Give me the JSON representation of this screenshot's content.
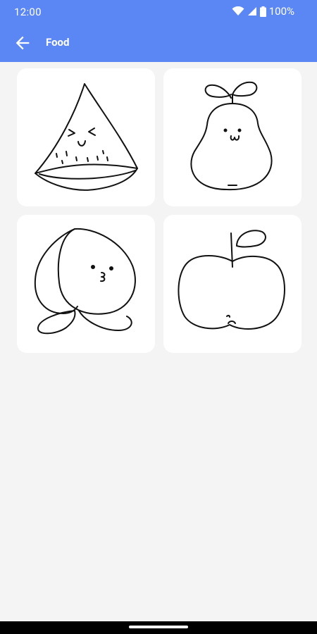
{
  "status": {
    "time": "12:00",
    "battery": "100%",
    "icons": [
      "wifi-icon",
      "signal-icon",
      "battery-icon"
    ]
  },
  "appbar": {
    "title": "Food",
    "back_icon": "arrow-back-icon"
  },
  "colors": {
    "accent": "#5b87f5",
    "background": "#f4f4f4",
    "card": "#ffffff"
  },
  "items": [
    {
      "id": "watermelon"
    },
    {
      "id": "pear"
    },
    {
      "id": "peach"
    },
    {
      "id": "apple"
    }
  ]
}
